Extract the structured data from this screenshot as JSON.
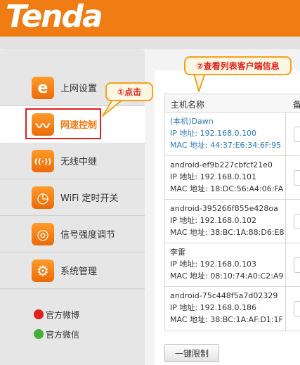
{
  "brand": {
    "logo_text": "Tenda",
    "accent": "#f07c14"
  },
  "sidebar": {
    "items": [
      {
        "label": "上网设置",
        "icon": "ie-icon",
        "glyph": "e"
      },
      {
        "label": "网速控制",
        "icon": "speed-wave-icon",
        "glyph": "〰",
        "active": true
      },
      {
        "label": "无线中继",
        "icon": "wireless-relay-icon",
        "glyph": "((·))"
      },
      {
        "label": "WiFi 定时开关",
        "icon": "timer-icon",
        "glyph": "◷"
      },
      {
        "label": "信号强度调节",
        "icon": "signal-icon",
        "glyph": "◎"
      },
      {
        "label": "系统管理",
        "icon": "gear-icon",
        "glyph": "⚙"
      }
    ],
    "social": [
      {
        "label": "官方微博",
        "icon": "weibo-icon",
        "color": "#e0201a"
      },
      {
        "label": "官方微信",
        "icon": "wechat-icon",
        "color": "#44b035"
      }
    ]
  },
  "annotations": {
    "step1": "①点击",
    "step2": "②查看列表客户端信息"
  },
  "table": {
    "headers": [
      "主机名称",
      "备"
    ],
    "rows": [
      {
        "name": "(本机)Dawn",
        "ip": "IP 地址: 192.168.0.100",
        "mac": "MAC 地址: 44:37:E6:34:6F:95",
        "self": true
      },
      {
        "name": "android-ef9b227cbfcf21e0",
        "ip": "IP 地址: 192.168.0.101",
        "mac": "MAC 地址: 18:DC:56:A4:06:FA"
      },
      {
        "name": "android-395266f855e428oa",
        "ip": "IP 地址: 192.168.0.102",
        "mac": "MAC 地址: 38:BC:1A:88:D6:E8"
      },
      {
        "name": "李雷",
        "ip": "IP 地址: 192.168.0.103",
        "mac": "MAC 地址: 08:10:74:A0:C2:A9"
      },
      {
        "name": "android-75c448f5a7d02329",
        "ip": "IP 地址: 192.168.0.186",
        "mac": "MAC 地址: 38:BC:1A:AF:D1:1F"
      }
    ]
  },
  "buttons": {
    "limit_all": "一键限制"
  }
}
